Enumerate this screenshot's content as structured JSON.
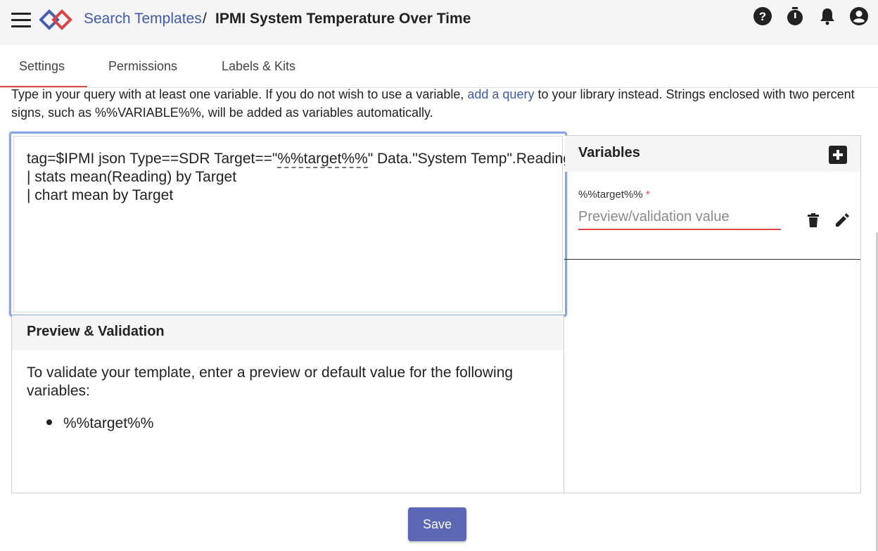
{
  "header": {
    "menu_icon": "hamburger-menu-icon",
    "logo_icon": "brand-logo",
    "breadcrumb_link": "Search Templates",
    "breadcrumb_separator": "/",
    "title": "IPMI System Temperature Over Time",
    "icons": [
      "help-icon",
      "timer-icon",
      "notifications-icon",
      "account-icon"
    ]
  },
  "tabs": [
    {
      "label": "Settings",
      "active": true
    },
    {
      "label": "Permissions",
      "active": false
    },
    {
      "label": "Labels & Kits",
      "active": false
    }
  ],
  "description": {
    "text_before": "Type in your query with at least one variable. If you do not wish to use a variable, ",
    "link": "add a query",
    "text_after": " to your library instead. Strings enclosed with two percent signs, such as %%VARIABLE%%, will be added as variables automatically."
  },
  "query": {
    "line1_before": "tag=$IPMI json Type==SDR Target==\"",
    "line1_variable": "%%target%%",
    "line1_after": "\" Data.\"System Temp\".Reading",
    "line2": "| stats mean(Reading) by Target",
    "line3": "| chart mean by Target"
  },
  "preview": {
    "title": "Preview & Validation",
    "text": "To validate your template, enter a preview or default value for the following variables:",
    "variables": [
      "%%target%%"
    ]
  },
  "variables_panel": {
    "title": "Variables",
    "add_icon": "add-box-icon",
    "items": [
      {
        "label": "%%target%%",
        "required_mark": "*",
        "value": "",
        "placeholder": "Preview/validation value",
        "delete_icon": "delete-icon",
        "edit_icon": "edit-icon"
      }
    ]
  },
  "actions": {
    "save_label": "Save"
  },
  "colors": {
    "brand_link": "#3f5aa8",
    "accent_red": "#e04848",
    "save_button": "#5b67b4",
    "editor_focus": "#86a6e6"
  }
}
